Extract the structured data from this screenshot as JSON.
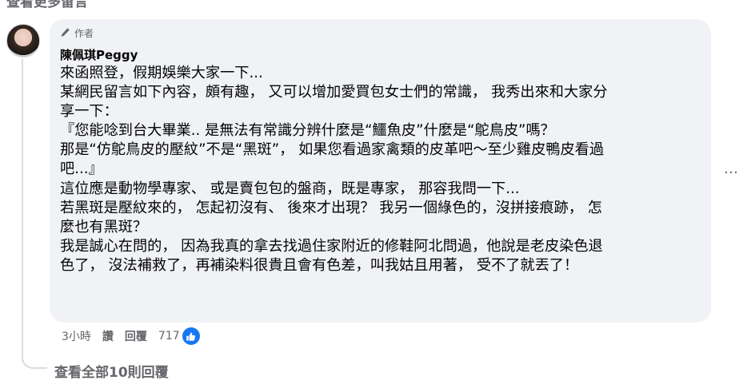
{
  "top_partial_text": "查看更多留言",
  "comment": {
    "author_badge": "作者",
    "author_name": "陳佩琪Peggy",
    "lines": [
      "來函照登，假期娛樂大家一下...",
      "某網民留言如下內容，頗有趣， 又可以增加愛買包女士們的常識， 我秀出來和大家分",
      "享一下：",
      "『您能唸到台大畢業.. 是無法有常識分辨什麼是“鱷魚皮”什麼是“鴕鳥皮”嗎？",
      "那是“仿鴕鳥皮的壓紋”不是“黑斑”， 如果您看過家禽類的皮革吧～至少雞皮鴨皮看過",
      "吧...』",
      "這位應是動物學專家、 或是賣包包的盤商，既是專家， 那容我問一下...",
      "若黑斑是壓紋來的， 怎起初沒有、 後來才出現？ 我另一個綠色的，沒拼接痕跡， 怎",
      "麼也有黑斑？",
      "我是誠心在問的， 因為我真的拿去找過住家附近的修鞋阿北問過，他說是老皮染色退",
      "色了， 沒法補救了，再補染料很貴且會有色差，叫我姑且用著， 受不了就丟了！"
    ]
  },
  "actions": {
    "time": "3小時",
    "like": "讚",
    "reply": "回覆",
    "reaction_count": "717"
  },
  "more_label": "…",
  "see_all_replies": "查看全部10則回覆",
  "colors": {
    "bubble": "#f0f2f5",
    "secondary_text": "#65676b",
    "like_blue": "#1877f2"
  }
}
